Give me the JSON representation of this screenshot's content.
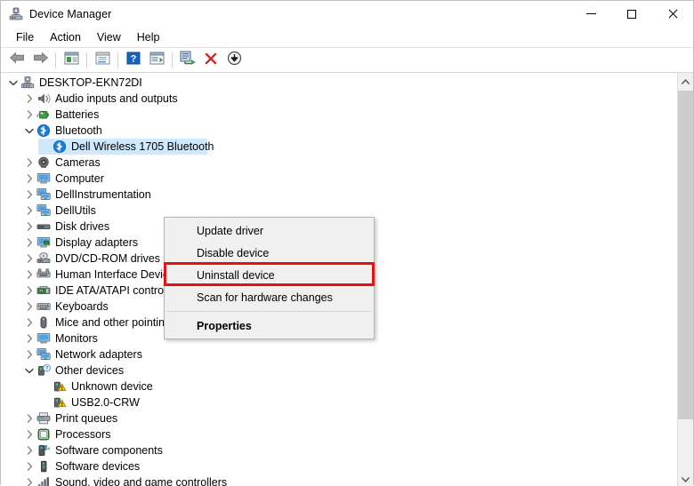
{
  "window": {
    "title": "Device Manager",
    "icon": "device-manager-icon",
    "controls": {
      "minimize": "—",
      "maximize": "□",
      "close": "✕"
    }
  },
  "menubar": {
    "items": [
      {
        "label": "File"
      },
      {
        "label": "Action"
      },
      {
        "label": "View"
      },
      {
        "label": "Help"
      }
    ]
  },
  "toolbar": {
    "buttons": [
      {
        "name": "back-arrow-icon",
        "tooltip": "Back"
      },
      {
        "name": "forward-arrow-icon",
        "tooltip": "Forward"
      },
      {
        "name": "show-hide-console-tree-icon",
        "tooltip": "Show/Hide Console Tree"
      },
      {
        "name": "properties-icon",
        "tooltip": "Properties"
      },
      {
        "name": "help-icon",
        "tooltip": "Help"
      },
      {
        "name": "show-hide-action-pane-icon",
        "tooltip": "Show/Hide Action Pane"
      },
      {
        "name": "scan-for-hardware-changes-icon",
        "tooltip": "Scan for hardware changes"
      },
      {
        "name": "enable-device-icon",
        "tooltip": "Enable device"
      },
      {
        "name": "uninstall-device-icon",
        "tooltip": "Uninstall device"
      },
      {
        "name": "update-driver-icon",
        "tooltip": "Update driver"
      }
    ]
  },
  "tree": {
    "nodes": [
      {
        "label": "DESKTOP-EKN72DI",
        "indent": 0,
        "expander": "expanded",
        "icon": "computer-root-icon",
        "selected": false
      },
      {
        "label": "Audio inputs and outputs",
        "indent": 1,
        "expander": "collapsed",
        "icon": "speaker-icon",
        "selected": false
      },
      {
        "label": "Batteries",
        "indent": 1,
        "expander": "collapsed",
        "icon": "battery-icon",
        "selected": false
      },
      {
        "label": "Bluetooth",
        "indent": 1,
        "expander": "expanded",
        "icon": "bluetooth-icon",
        "selected": false
      },
      {
        "label": "Dell Wireless 1705 Bluetooth",
        "indent": 2,
        "expander": "none",
        "icon": "bluetooth-icon",
        "selected": true
      },
      {
        "label": "Cameras",
        "indent": 1,
        "expander": "collapsed",
        "icon": "camera-icon",
        "selected": false
      },
      {
        "label": "Computer",
        "indent": 1,
        "expander": "collapsed",
        "icon": "monitor-icon",
        "selected": false
      },
      {
        "label": "DellInstrumentation",
        "indent": 1,
        "expander": "collapsed",
        "icon": "network-monitor-icon",
        "selected": false
      },
      {
        "label": "DellUtils",
        "indent": 1,
        "expander": "collapsed",
        "icon": "network-monitor-icon",
        "selected": false
      },
      {
        "label": "Disk drives",
        "indent": 1,
        "expander": "collapsed",
        "icon": "disk-drive-icon",
        "selected": false
      },
      {
        "label": "Display adapters",
        "indent": 1,
        "expander": "collapsed",
        "icon": "display-adapter-icon",
        "selected": false
      },
      {
        "label": "DVD/CD-ROM drives",
        "indent": 1,
        "expander": "collapsed",
        "icon": "optical-drive-icon",
        "selected": false
      },
      {
        "label": "Human Interface Devices",
        "indent": 1,
        "expander": "collapsed",
        "icon": "hid-icon",
        "selected": false
      },
      {
        "label": "IDE ATA/ATAPI controllers",
        "indent": 1,
        "expander": "collapsed",
        "icon": "ide-controller-icon",
        "selected": false
      },
      {
        "label": "Keyboards",
        "indent": 1,
        "expander": "collapsed",
        "icon": "keyboard-icon",
        "selected": false
      },
      {
        "label": "Mice and other pointing devices",
        "indent": 1,
        "expander": "collapsed",
        "icon": "mouse-icon",
        "selected": false
      },
      {
        "label": "Monitors",
        "indent": 1,
        "expander": "collapsed",
        "icon": "monitor-icon",
        "selected": false
      },
      {
        "label": "Network adapters",
        "indent": 1,
        "expander": "collapsed",
        "icon": "network-monitor-icon",
        "selected": false
      },
      {
        "label": "Other devices",
        "indent": 1,
        "expander": "expanded",
        "icon": "unknown-device-icon",
        "selected": false
      },
      {
        "label": "Unknown device",
        "indent": 2,
        "expander": "none",
        "icon": "warning-device-icon",
        "selected": false
      },
      {
        "label": "USB2.0-CRW",
        "indent": 2,
        "expander": "none",
        "icon": "warning-device-icon",
        "selected": false
      },
      {
        "label": "Print queues",
        "indent": 1,
        "expander": "collapsed",
        "icon": "printer-icon",
        "selected": false
      },
      {
        "label": "Processors",
        "indent": 1,
        "expander": "collapsed",
        "icon": "processor-icon",
        "selected": false
      },
      {
        "label": "Software components",
        "indent": 1,
        "expander": "collapsed",
        "icon": "software-component-icon",
        "selected": false
      },
      {
        "label": "Software devices",
        "indent": 1,
        "expander": "collapsed",
        "icon": "software-device-icon",
        "selected": false
      },
      {
        "label": "Sound, video and game controllers",
        "indent": 1,
        "expander": "collapsed",
        "icon": "sound-controller-icon",
        "selected": false
      }
    ]
  },
  "context_menu": {
    "items": [
      {
        "label": "Update driver",
        "bold": false,
        "separator_after": false
      },
      {
        "label": "Disable device",
        "bold": false,
        "separator_after": false
      },
      {
        "label": "Uninstall device",
        "bold": false,
        "separator_after": false
      },
      {
        "label": "Scan for hardware changes",
        "bold": false,
        "separator_after": true
      },
      {
        "label": "Properties",
        "bold": true,
        "separator_after": false
      }
    ],
    "highlight_color": "#e8110f",
    "highlighted_item": "Uninstall device"
  },
  "colors": {
    "selection": "#cde8ff",
    "menu_bg": "#f0f0f0",
    "window_bg": "#ffffff",
    "scrollbar_thumb": "#cdcdcd"
  }
}
